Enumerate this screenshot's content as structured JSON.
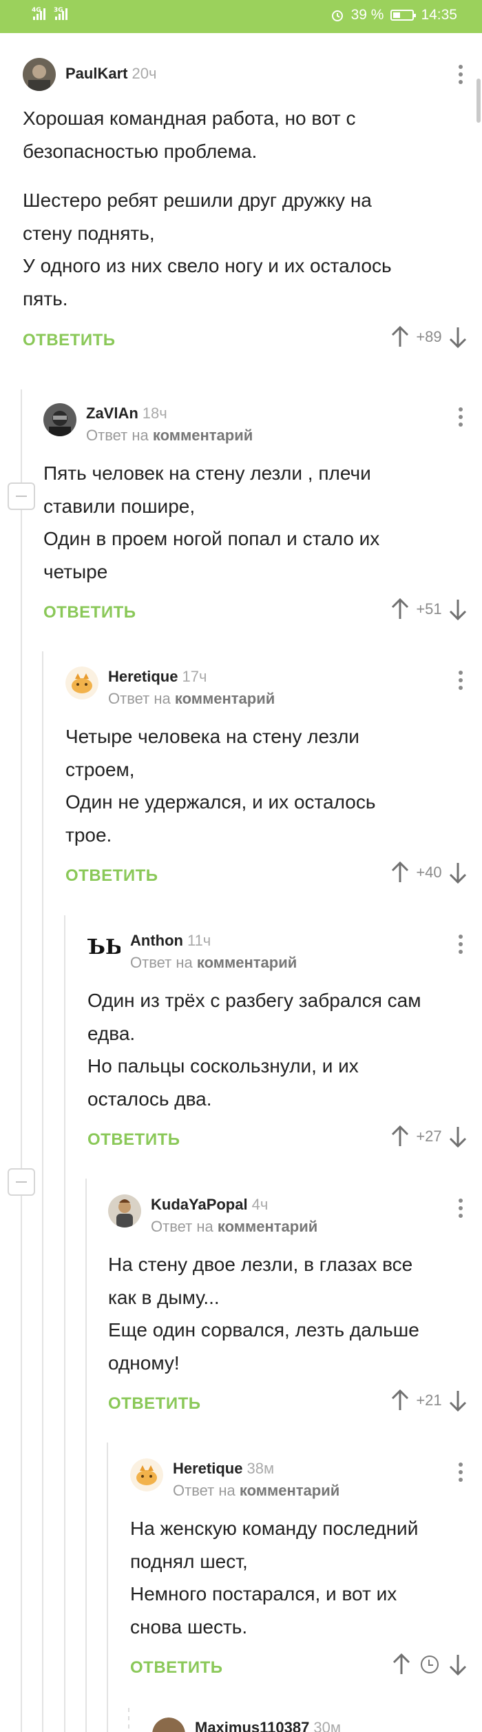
{
  "status_bar": {
    "signal1_label": "4G",
    "signal2_label": "3G",
    "battery": "39 %",
    "time": "14:35"
  },
  "reply_label": "ОТВЕТИТЬ",
  "reply_to_prefix": "Ответ на",
  "reply_to_target": "комментарий",
  "comments": [
    {
      "author": "PaulKart",
      "time": "20ч",
      "paragraphs": [
        "Хорошая командная работа, но вот с\nбезопасностью проблема.",
        "Шестеро ребят решили друг дружку на\nстену поднять,\nУ одного из них свело ногу и их осталось\nпять."
      ],
      "score": "+89"
    },
    {
      "author": "ZaVlAn",
      "time": "18ч",
      "paragraphs": [
        "Пять человек на стену лезли , плечи\nставили пошире,\nОдин в проем ногой попал и стало их\nчетыре"
      ],
      "score": "+51"
    },
    {
      "author": "Heretique",
      "time": "17ч",
      "paragraphs": [
        "Четыре человека на стену лезли\nстроем,\nОдин не удержался, и их осталось\nтрое."
      ],
      "score": "+40"
    },
    {
      "author": "Anthon",
      "time": "11ч",
      "avatar_text": "ЪЬ",
      "paragraphs": [
        "Один из трёх с разбегу забрался сам\nедва.\nНо пальцы соскользнули, и их\nосталось два."
      ],
      "score": "+27"
    },
    {
      "author": "KudaYaPopal",
      "time": "4ч",
      "paragraphs": [
        "На стену двое лезли, в глазах все\nкак в дыму...\nЕще один сорвался, лезть дальше\nодному!"
      ],
      "score": "+21"
    },
    {
      "author": "Heretique",
      "time": "38м",
      "paragraphs": [
        "На женскую команду последний\nподнял шест,\nНемного постарался, и вот их\nснова шесть."
      ],
      "score": ""
    },
    {
      "author": "Maximus110387",
      "time": "30м"
    }
  ]
}
